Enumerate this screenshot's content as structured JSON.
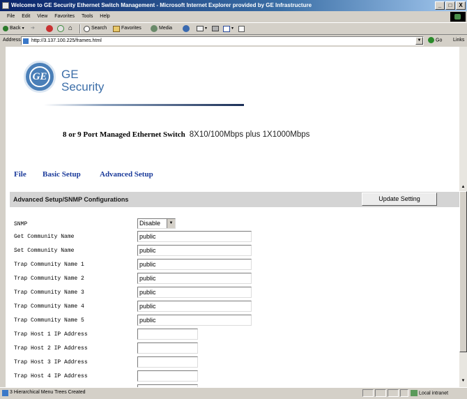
{
  "window": {
    "title": "Welcome to GE Security Ethernet Switch Management - Microsoft Internet Explorer provided by GE Infrastructure",
    "minimize_label": "_",
    "restore_label": "□",
    "close_label": "X"
  },
  "menu": [
    "File",
    "Edit",
    "View",
    "Favorites",
    "Tools",
    "Help"
  ],
  "toolbar": {
    "back": "Back",
    "search": "Search",
    "favorites": "Favorites",
    "media": "Media"
  },
  "address": {
    "label": "Address",
    "url": "http://3.137.100.225/frames.html",
    "go_label": "Go",
    "links_label": "Links"
  },
  "page": {
    "logo_text": "GE",
    "brand_line1": "GE",
    "brand_line2": "Security",
    "product_name": "8 or 9 Port Managed Ethernet Switch",
    "product_spec": "8X10/100Mbps plus 1X1000Mbps",
    "nav": [
      "File",
      "Basic Setup",
      "Advanced Setup"
    ],
    "section_title": "Advanced Setup/SNMP Configurations",
    "update_button": "Update Setting",
    "snmp_label": "SNMP",
    "snmp_value": "Disable",
    "fields": [
      {
        "label": "Get Community Name",
        "value": "public"
      },
      {
        "label": "Set Community Name",
        "value": "public"
      },
      {
        "label": "Trap Community Name 1",
        "value": "public"
      },
      {
        "label": "Trap Community Name 2",
        "value": "public"
      },
      {
        "label": "Trap Community Name 3",
        "value": "public"
      },
      {
        "label": "Trap Community Name 4",
        "value": "public"
      },
      {
        "label": "Trap Community Name 5",
        "value": "public"
      }
    ],
    "hosts": [
      {
        "label": "Trap Host 1 IP Address",
        "value": ""
      },
      {
        "label": "Trap Host 2 IP Address",
        "value": ""
      },
      {
        "label": "Trap Host 3 IP Address",
        "value": ""
      },
      {
        "label": "Trap Host 4 IP Address",
        "value": ""
      }
    ]
  },
  "status": {
    "message": "3 Hierarchical Menu Trees Created",
    "zone": "Local intranet"
  }
}
